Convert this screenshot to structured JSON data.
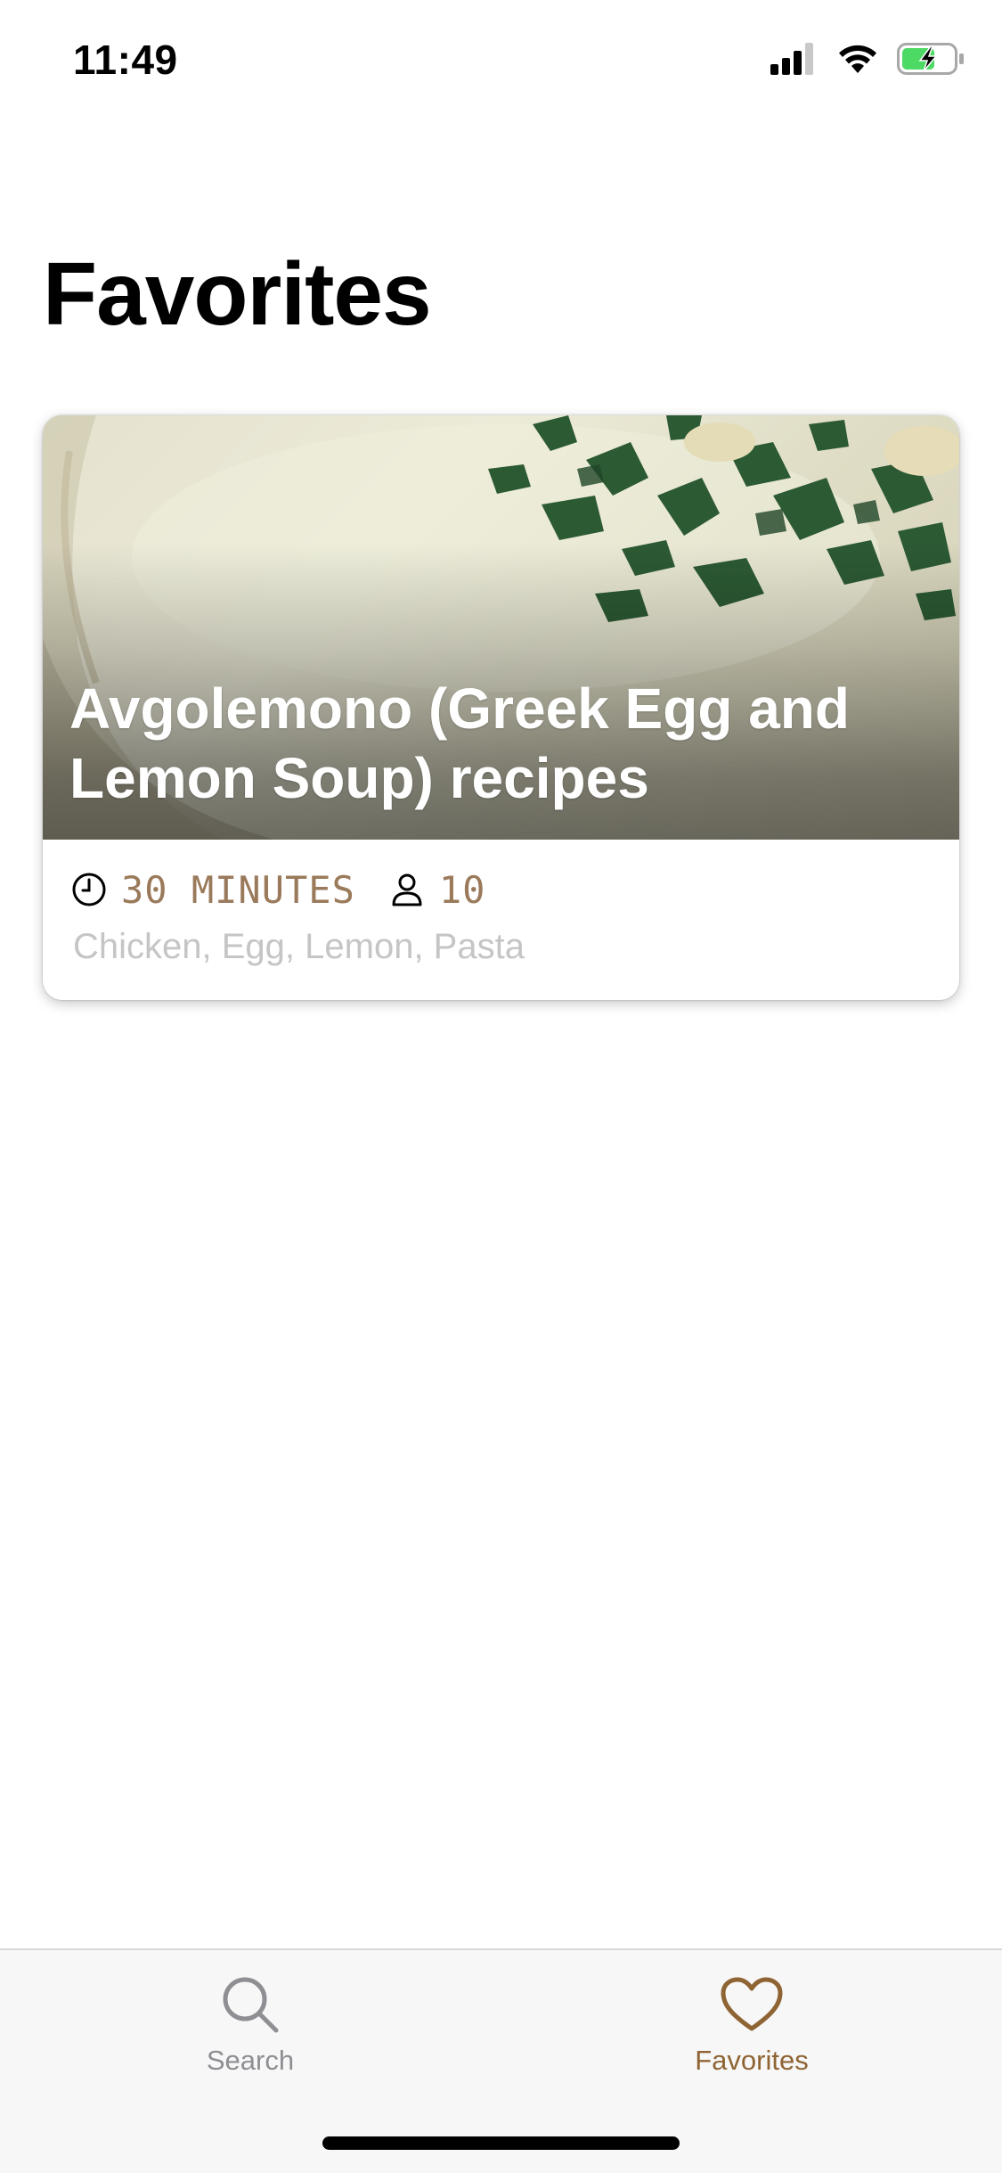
{
  "status_bar": {
    "time": "11:49",
    "icons": [
      "cellular-signal-icon",
      "wifi-icon",
      "battery-charging-icon"
    ]
  },
  "page": {
    "title": "Favorites"
  },
  "favorites": [
    {
      "title": "Avgolemono (Greek Egg and Lemon Soup) recipes",
      "time": "30 MINUTES",
      "servings": "10",
      "ingredients": "Chicken, Egg, Lemon, Pasta"
    }
  ],
  "tab_bar": {
    "tabs": [
      {
        "label": "Search",
        "icon": "search-icon",
        "selected": false
      },
      {
        "label": "Favorites",
        "icon": "heart-icon",
        "selected": true
      }
    ]
  },
  "colors": {
    "accent": "#8f6434",
    "meta_text": "#9a7a5a",
    "ingredients_text": "#c5c5c7",
    "tab_inactive": "#8e8e93",
    "battery_fill": "#4cd964"
  }
}
